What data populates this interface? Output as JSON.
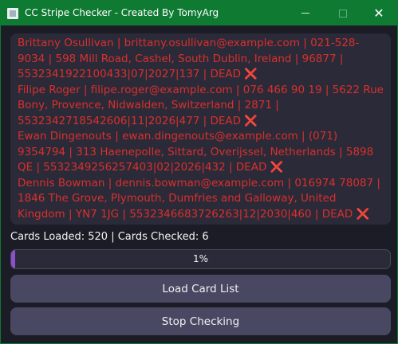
{
  "window": {
    "title": "CC Stripe Checker - Created By TomyArg",
    "close_glyph": "✕"
  },
  "log": {
    "entries": [
      "Brittany Osullivan | brittany.osullivan@example.com | 021-528-9034 | 598 Mill Road, Cashel, South Dublin, Ireland | 96877 | 5532341922100433|07|2027|137 | DEAD",
      "Filipe Roger | filipe.roger@example.com | 076 466 90 19 | 5622 Rue Bony, Provence, Nidwalden, Switzerland | 2871 | 5532342718542606|11|2026|477 | DEAD",
      "Ewan Dingenouts | ewan.dingenouts@example.com | (071) 9354794 | 313 Haenepolle, Sittard, Overijssel, Netherlands | 5898 QE | 5532349256257403|02|2026|432 | DEAD",
      "Dennis Bowman | dennis.bowman@example.com | 016974 78087 | 1846 The Grove, Plymouth, Dumfries and Galloway, United Kingdom | YN7 1JG | 5532346683726263|12|2030|460 | DEAD"
    ],
    "dead_glyph": "❌",
    "text_color": "#d9302b"
  },
  "status": {
    "text": "Cards Loaded: 520 | Cards Checked: 6"
  },
  "progress": {
    "value_fraction": 0.01,
    "label": "1%",
    "fill_color": "#8a52c8"
  },
  "buttons": {
    "load_label": "Load Card List",
    "stop_label": "Stop Checking"
  },
  "colors": {
    "titlebar": "#0f7a32",
    "background": "#1c1c27",
    "panel": "#2b2a39",
    "button": "#484863"
  }
}
